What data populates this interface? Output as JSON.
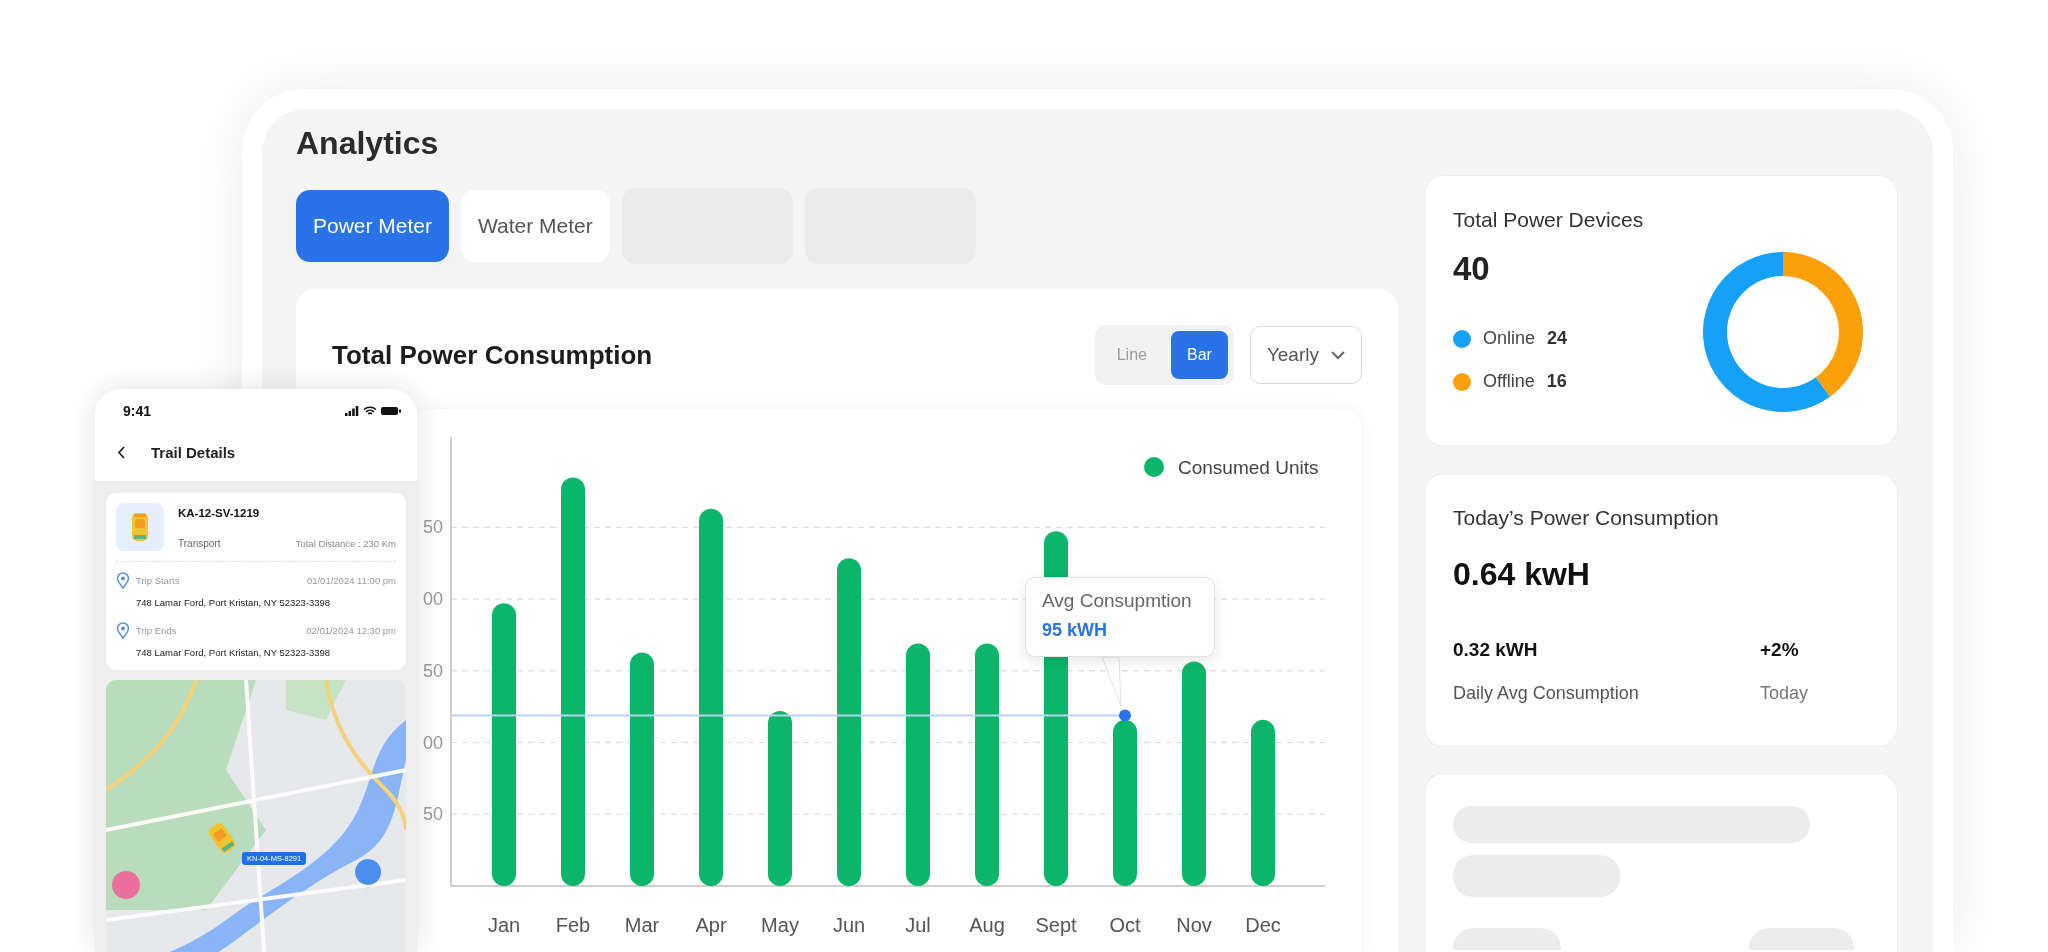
{
  "title": "Analytics",
  "tabs": [
    {
      "kind": "tab",
      "label": "Power Meter",
      "selected": true
    },
    {
      "kind": "tab",
      "label": "Water Meter",
      "selected": false
    },
    {
      "kind": "placeholder"
    },
    {
      "kind": "placeholder"
    }
  ],
  "consumption_card": {
    "title": "Total Power Consumption",
    "view_toggle": [
      {
        "label": "Line",
        "selected": false
      },
      {
        "label": "Bar",
        "selected": true
      }
    ],
    "period": "Yearly",
    "tooltip": {
      "label": "Avg Consupmtion",
      "value": "95 kWH"
    },
    "legend": "Consumed Units",
    "months": [
      "Jan",
      "Feb",
      "Mar",
      "Apr",
      "May",
      "Jun",
      "Jul",
      "Aug",
      "Sept",
      "Oct",
      "Nov",
      "Dec"
    ],
    "y_axis_labels": [
      "50",
      "00",
      "50",
      "00",
      "50"
    ]
  },
  "devices_card": {
    "title": "Total Power Devices",
    "total": "40",
    "items": [
      {
        "count": "24",
        "color": "#15a1f8"
      },
      {
        "count": "16",
        "color": "#fb9f0b"
      }
    ],
    "chart_data": {
      "type": "donut",
      "categories": [
        "Online",
        "Offline"
      ],
      "values": [
        60,
        40
      ]
    }
  },
  "today_card": {
    "title": "Today’s Power Consumption",
    "value": "0.64 kwH",
    "stats": [
      {
        "value": "0.32 kWH",
        "label": "Daily Avg Consumption"
      },
      {
        "value": "+2%",
        "label": "Today"
      }
    ]
  },
  "loading_card": {
    "loading": true
  },
  "phone": {
    "time": "9:41",
    "title": "Trail Details",
    "vehicle": {
      "plate": "KA-12-SV-1219",
      "type": "Transport",
      "distance": "Total Distance : 230 Km"
    },
    "trip": [
      {
        "label": "Trip Starts",
        "time": "01/01/2024 11:00 pm",
        "address": "748 Lamar Ford, Port Kristan, NY 52323-3398"
      },
      {
        "label": "Trip Ends",
        "time": "02/01/2024 12:30 pm",
        "address": "748 Lamar Ford, Port Kristan, NY 52323-3398"
      }
    ],
    "map": {
      "kind": "picture",
      "vehicle_tag": "KN-04-MS-8291"
    }
  }
}
